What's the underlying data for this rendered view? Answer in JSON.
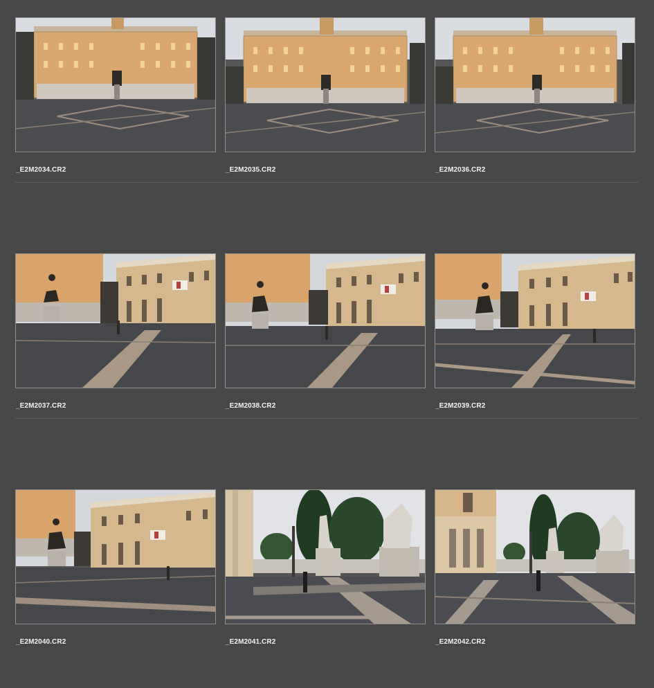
{
  "thumbnails": [
    {
      "filename": "_E2M2034.CR2",
      "scene": "front-palazzo-lit-icon"
    },
    {
      "filename": "_E2M2035.CR2",
      "scene": "front-palazzo-lit-icon"
    },
    {
      "filename": "_E2M2036.CR2",
      "scene": "front-palazzo-lit-icon"
    },
    {
      "filename": "_E2M2037.CR2",
      "scene": "angled-piazza-statue-icon"
    },
    {
      "filename": "_E2M2038.CR2",
      "scene": "angled-piazza-statue-icon"
    },
    {
      "filename": "_E2M2039.CR2",
      "scene": "angled-piazza-statue-icon"
    },
    {
      "filename": "_E2M2040.CR2",
      "scene": "angled-piazza-statue-icon"
    },
    {
      "filename": "_E2M2041.CR2",
      "scene": "balustrade-statues-trees-icon"
    },
    {
      "filename": "_E2M2042.CR2",
      "scene": "balustrade-statues-trees-icon"
    }
  ],
  "colors": {
    "background": "#474747",
    "thumb_border": "#8f8f8f",
    "filename_text": "#f2f2f2",
    "separator": "#5a5a5a"
  }
}
